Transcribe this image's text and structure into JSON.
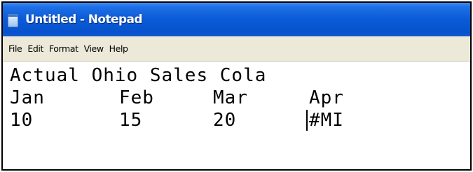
{
  "window": {
    "title": "Untitled - Notepad",
    "icon": "notepad-icon",
    "titlebar_color": "#0a5ad8"
  },
  "menu": {
    "items": [
      "File",
      "Edit",
      "Format",
      "View",
      "Help"
    ]
  },
  "editor": {
    "line1": "Actual Ohio Sales Cola",
    "months": [
      "Jan",
      "Feb",
      "Mar",
      "Apr"
    ],
    "values": [
      "10",
      "15",
      "20",
      "#MI"
    ]
  }
}
